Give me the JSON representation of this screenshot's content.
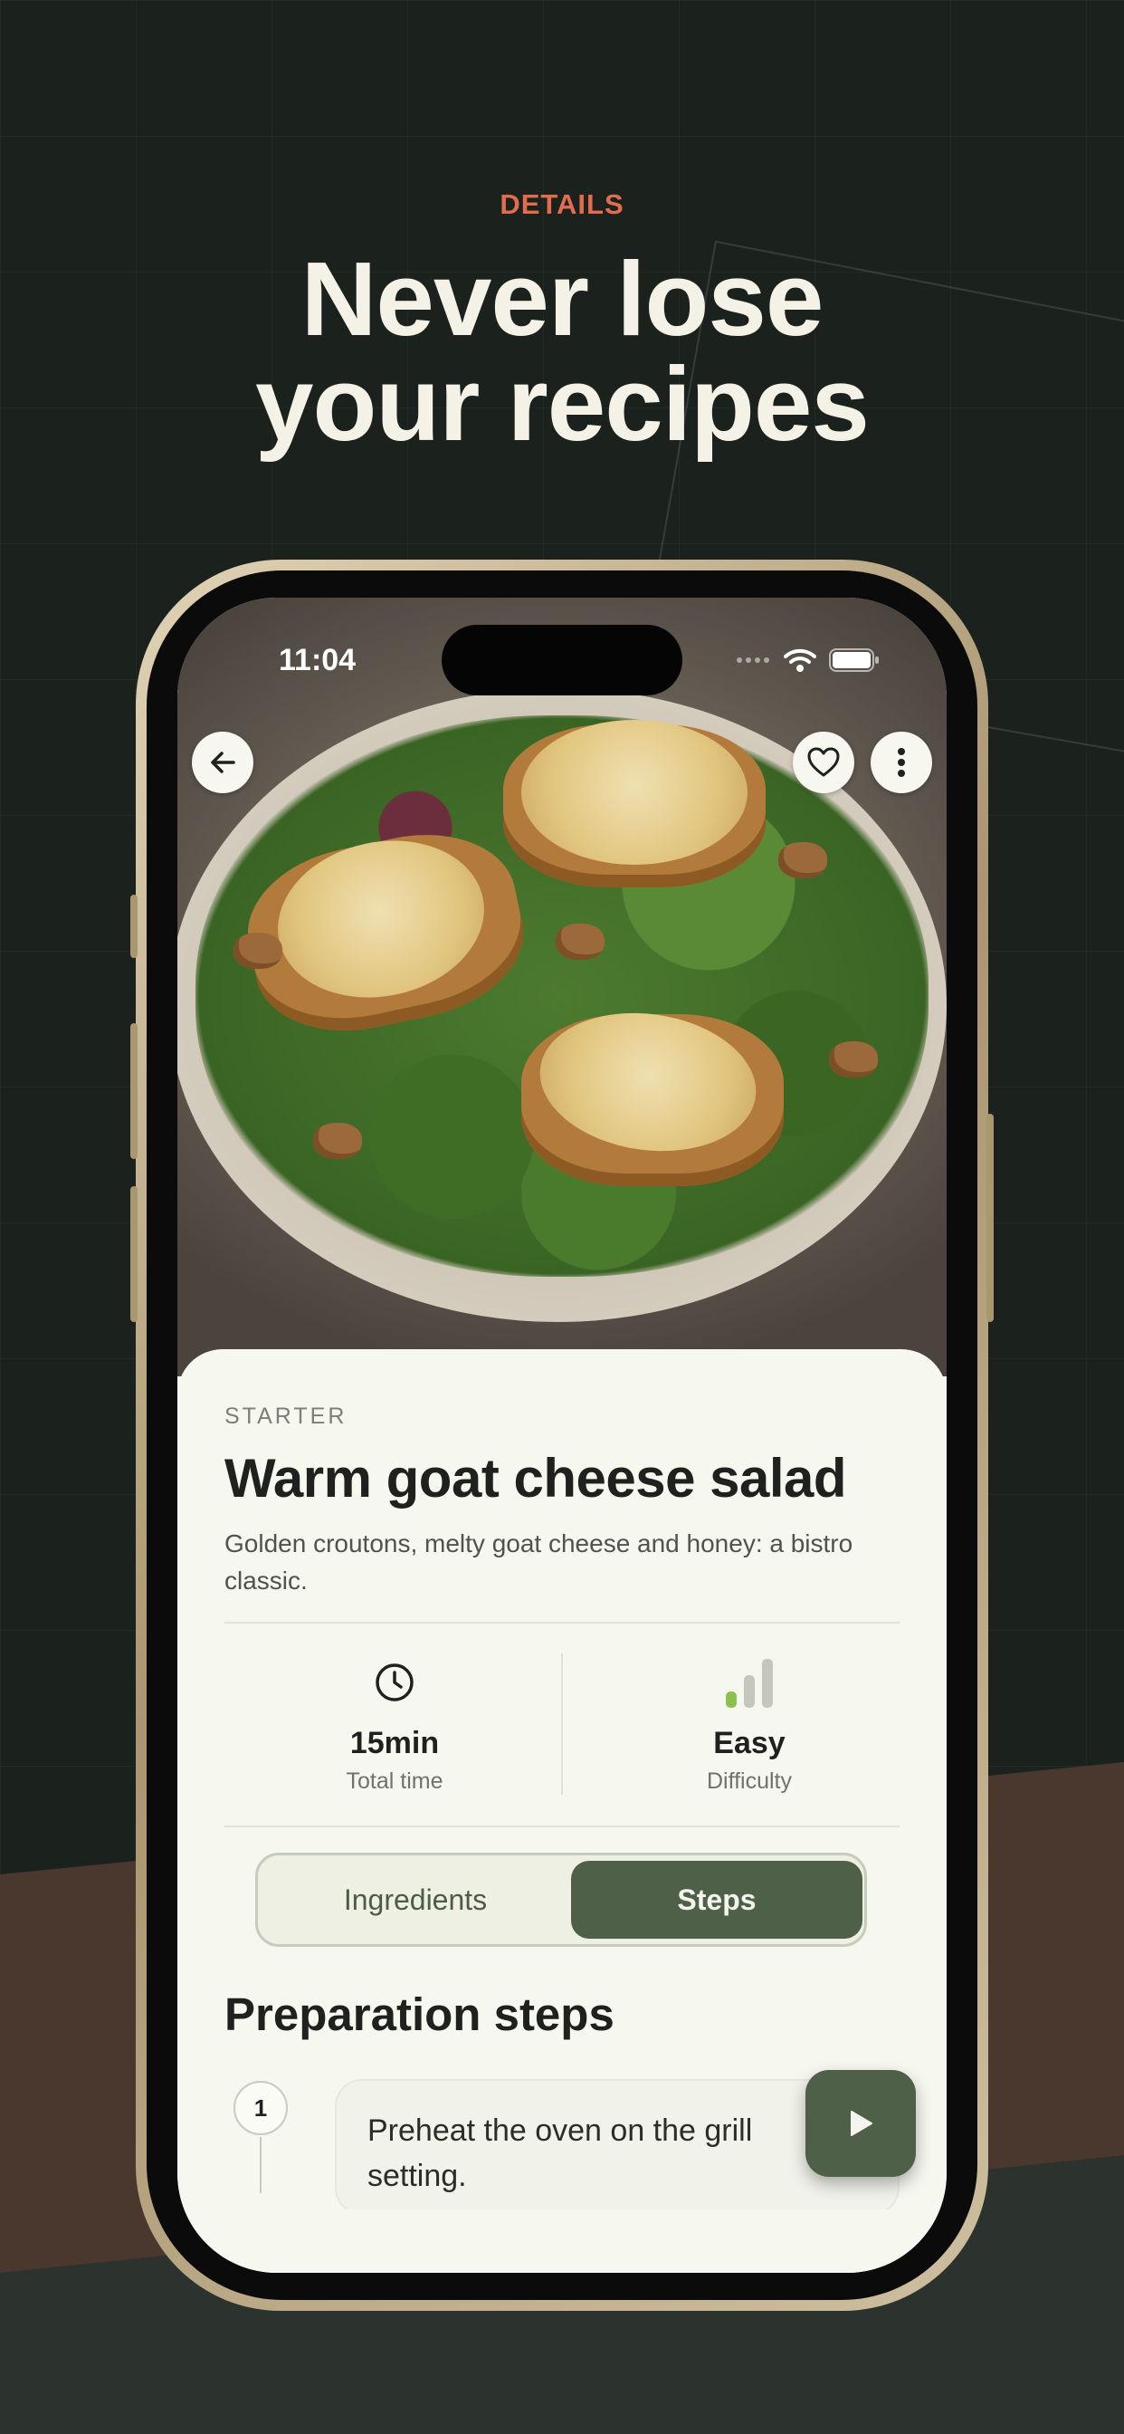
{
  "promo": {
    "eyebrow": "DETAILS",
    "headline_line1": "Never lose",
    "headline_line2": "your recipes"
  },
  "status_bar": {
    "time": "11:04"
  },
  "top_actions": {
    "back_icon": "arrow-left-icon",
    "favorite_icon": "heart-icon",
    "more_icon": "more-vertical-icon"
  },
  "recipe": {
    "category": "STARTER",
    "title": "Warm goat cheese salad",
    "description": "Golden croutons, melty goat cheese and honey: a bistro classic.",
    "stats": [
      {
        "icon": "clock-icon",
        "value": "15min",
        "label": "Total time"
      },
      {
        "icon": "difficulty-bars-icon",
        "value": "Easy",
        "label": "Difficulty",
        "level": 1,
        "max_level": 3
      }
    ]
  },
  "tabs": {
    "items": [
      "Ingredients",
      "Steps"
    ],
    "selected": "Steps"
  },
  "steps_section": {
    "title": "Preparation steps",
    "steps": [
      {
        "number": "1",
        "text": "Preheat the oven on the grill setting."
      }
    ],
    "play_icon": "play-icon"
  },
  "colors": {
    "background": "#1b211d",
    "accent": "#e26d4e",
    "primary_green": "#4e6048",
    "card": "#f6f7ef"
  }
}
